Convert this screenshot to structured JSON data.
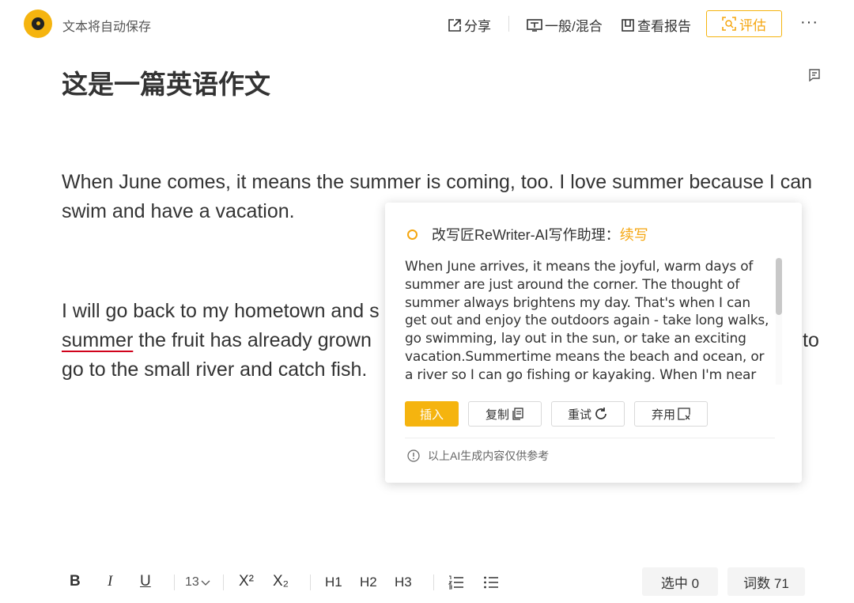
{
  "header": {
    "autosave_text": "文本将自动保存",
    "share_label": "分享",
    "mode_label": "一般/混合",
    "report_label": "查看报告",
    "evaluate_label": "评估",
    "more_label": "···"
  },
  "document": {
    "title": "这是一篇英语作文",
    "paragraph1": "When June comes, it means the summer is coming, too. I love summer because I can swim and have a vacation.",
    "paragraph2": {
      "line1": "I will go back to my hometown and s",
      "underlined_word": "summer",
      "line2_rest": " the fruit has already grown",
      "line2_right": "to",
      "line3": "go to the small river and catch fish."
    }
  },
  "popup": {
    "title": "改写匠ReWriter-AI写作助理：",
    "mode": "续写",
    "text": "When June arrives, it means the joyful, warm days of summer are just around the corner. The thought of summer always brightens my day. That's when I can get out and enjoy the outdoors again - take long walks, go swimming, lay out in the sun, or take an exciting vacation.Summertime means the beach and ocean, or a river so I can go fishing or kayaking. When I'm near the water I relax and enjoy the sounds of nature.",
    "buttons": {
      "insert": "插入",
      "copy": "复制",
      "retry": "重试",
      "discard": "弃用"
    },
    "disclaimer": "以上AI生成内容仅供参考"
  },
  "toolbar": {
    "bold": "B",
    "italic": "I",
    "underline": "U",
    "font_size": "13",
    "superscript": "X²",
    "subscript": "X₂",
    "h1": "H1",
    "h2": "H2",
    "h3": "H3",
    "selected_label": "选中 0",
    "word_count_label": "词数 71"
  },
  "colors": {
    "accent": "#f5b40f",
    "accent_text": "#f5a60f",
    "error_underline": "#d0021b"
  }
}
